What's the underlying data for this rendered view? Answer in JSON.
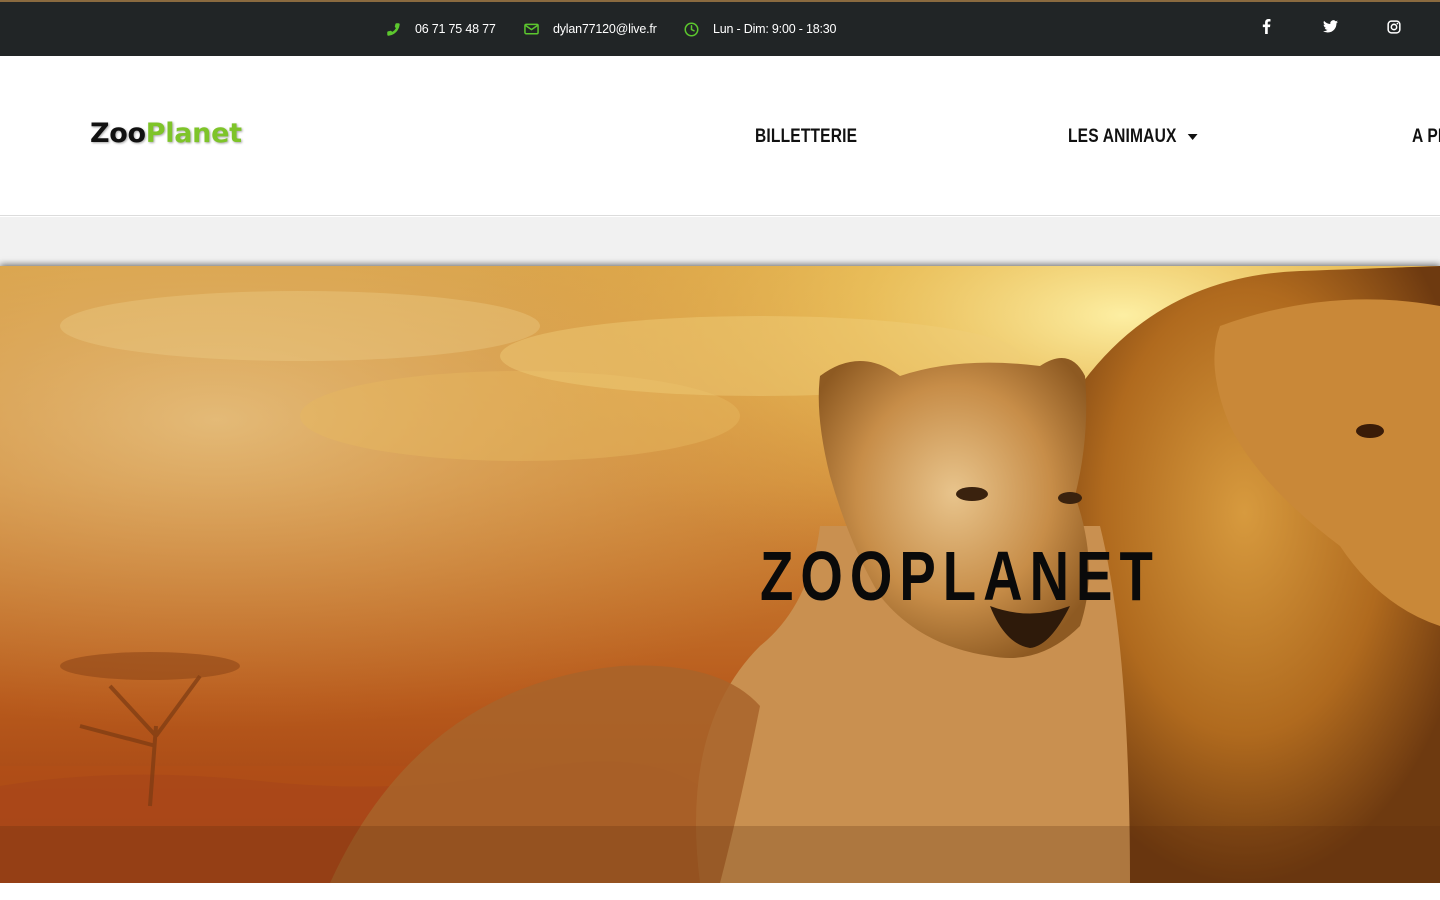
{
  "topbar": {
    "phone": "06 71 75 48 77",
    "email": "dylan77120@live.fr",
    "hours": "Lun - Dim: 9:00 - 18:30",
    "icon_color": "#5cc72e",
    "icons": [
      "phone-icon",
      "envelope-icon",
      "clock-icon"
    ],
    "social": [
      "facebook-icon",
      "twitter-icon",
      "instagram-icon"
    ]
  },
  "header": {
    "logo_part1": "Zoo",
    "logo_part2": "Planet",
    "logo_accent": "#7ec429",
    "nav": {
      "billetterie": "BILLETTERIE",
      "animaux": "LES ANIMAUX",
      "apropos": "A PI"
    }
  },
  "hero": {
    "title": "ZOOPLANET"
  }
}
